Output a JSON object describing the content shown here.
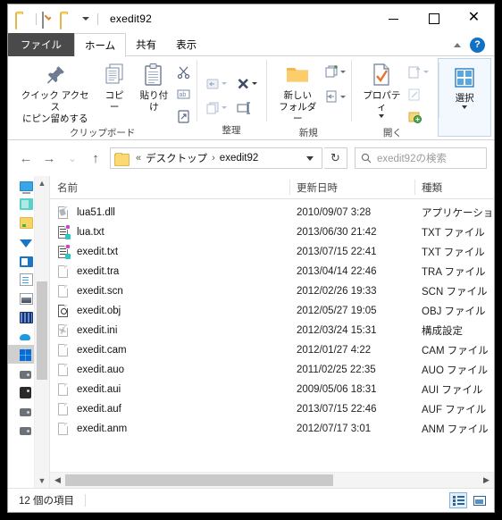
{
  "window": {
    "title": "exedit92",
    "quick_access": [
      "folder-icon",
      "properties-icon",
      "folder-icon"
    ],
    "controls": {
      "minimize": "minimize-icon",
      "maximize": "maximize-icon",
      "close": "close-icon"
    }
  },
  "tabs": [
    {
      "id": "file",
      "label": "ファイル"
    },
    {
      "id": "home",
      "label": "ホーム"
    },
    {
      "id": "share",
      "label": "共有"
    },
    {
      "id": "view",
      "label": "表示"
    }
  ],
  "ribbon": {
    "help_label": "?",
    "groups": [
      {
        "label": "クリップボード",
        "buttons": [
          {
            "label": "クイック アクセス\nにピン留めする",
            "label_line1": "クイック アクセス",
            "label_line2": "にピン留めする",
            "icon": "pin-icon"
          },
          {
            "label": "コピー",
            "icon": "copy-icon"
          },
          {
            "label": "貼り付け",
            "icon": "paste-icon"
          }
        ],
        "small_buttons": [
          {
            "name": "cut",
            "icon": "scissors-icon"
          },
          {
            "name": "copy-path",
            "icon": "copy-path-icon"
          },
          {
            "name": "paste-shortcut",
            "icon": "paste-shortcut-icon"
          }
        ]
      },
      {
        "label": "整理",
        "small_buttons": [
          {
            "name": "move-to",
            "icon": "move-to-icon"
          },
          {
            "name": "delete",
            "icon": "delete-x-icon"
          },
          {
            "name": "copy-to",
            "icon": "copy-to-icon"
          },
          {
            "name": "rename",
            "icon": "rename-icon"
          }
        ]
      },
      {
        "label": "新規",
        "buttons": [
          {
            "label": "新しい\nフォルダー",
            "label_line1": "新しい",
            "label_line2": "フォルダー",
            "icon": "new-folder-icon"
          }
        ],
        "small_buttons": [
          {
            "name": "new-item",
            "icon": "new-item-icon"
          },
          {
            "name": "easy-access",
            "icon": "easy-access-icon"
          }
        ]
      },
      {
        "label": "開く",
        "buttons": [
          {
            "label": "プロパティ",
            "icon": "properties-icon"
          }
        ],
        "small_buttons": [
          {
            "name": "open",
            "icon": "open-icon"
          },
          {
            "name": "edit",
            "icon": "edit-icon"
          },
          {
            "name": "history",
            "icon": "history-icon"
          }
        ]
      },
      {
        "label": "選択",
        "buttons": [
          {
            "label": "選択",
            "icon": "select-icon"
          }
        ]
      }
    ]
  },
  "addressbar": {
    "back": "back-arrow-icon",
    "forward": "forward-arrow-icon",
    "recent": "recent-locations-icon",
    "up": "up-arrow-icon",
    "folder_icon": "folder-icon",
    "overflow": "«",
    "crumbs": [
      "デスクトップ",
      "exedit92"
    ],
    "separator": "›",
    "dropdown": "chevron-down-icon",
    "refresh": "↻",
    "refresh_name": "refresh-icon"
  },
  "search": {
    "icon": "search-icon",
    "placeholder": "exedit92の検索"
  },
  "navpane": {
    "items": [
      {
        "name": "desktop",
        "icon": "monitor-icon",
        "selected": false
      },
      {
        "name": "onedrive",
        "icon": "teal-folder-icon",
        "selected": false
      },
      {
        "name": "documents",
        "icon": "yellow-folder-icon",
        "selected": false
      },
      {
        "name": "downloads",
        "icon": "download-arrow-icon",
        "selected": false
      },
      {
        "name": "this-pc",
        "icon": "blue-pc-icon",
        "selected": false
      },
      {
        "name": "docs-lib",
        "icon": "document-icon",
        "selected": false
      },
      {
        "name": "pictures",
        "icon": "picture-icon",
        "selected": false
      },
      {
        "name": "videos",
        "icon": "video-icon",
        "selected": false
      },
      {
        "name": "cloud",
        "icon": "cloud-icon",
        "selected": false
      },
      {
        "name": "windows-c",
        "icon": "windows-drive-icon",
        "selected": true
      },
      {
        "name": "drive-d",
        "icon": "drive-icon",
        "selected": false
      },
      {
        "name": "drive-e",
        "icon": "drive-dark-icon",
        "selected": false
      },
      {
        "name": "drive-f",
        "icon": "drive-icon",
        "selected": false
      },
      {
        "name": "drive-g",
        "icon": "drive-icon",
        "selected": false
      }
    ],
    "scroll_up": "▲",
    "scroll_down": "▼"
  },
  "columns": [
    {
      "id": "name",
      "label": "名前"
    },
    {
      "id": "date",
      "label": "更新日時"
    },
    {
      "id": "type",
      "label": "種類"
    }
  ],
  "files": [
    {
      "name": "lua51.dll",
      "date": "2010/09/07 3:28",
      "type": "アプリケーション",
      "icon": "dll-file-icon"
    },
    {
      "name": "lua.txt",
      "date": "2013/06/30 21:42",
      "type": "TXT ファイル",
      "icon": "text-file-icon"
    },
    {
      "name": "exedit.txt",
      "date": "2013/07/15 22:41",
      "type": "TXT ファイル",
      "icon": "text-file-icon"
    },
    {
      "name": "exedit.tra",
      "date": "2013/04/14 22:46",
      "type": "TRA ファイル",
      "icon": "generic-file-icon"
    },
    {
      "name": "exedit.scn",
      "date": "2012/02/26 19:33",
      "type": "SCN ファイル",
      "icon": "generic-file-icon"
    },
    {
      "name": "exedit.obj",
      "date": "2012/05/27 19:05",
      "type": "OBJ ファイル",
      "icon": "obj-file-icon"
    },
    {
      "name": "exedit.ini",
      "date": "2012/03/24 15:31",
      "type": "構成設定",
      "icon": "ini-file-icon"
    },
    {
      "name": "exedit.cam",
      "date": "2012/01/27 4:22",
      "type": "CAM ファイル",
      "icon": "generic-file-icon"
    },
    {
      "name": "exedit.auo",
      "date": "2011/02/25 22:35",
      "type": "AUO ファイル",
      "icon": "generic-file-icon"
    },
    {
      "name": "exedit.aui",
      "date": "2009/05/06 18:31",
      "type": "AUI ファイル",
      "icon": "generic-file-icon"
    },
    {
      "name": "exedit.auf",
      "date": "2013/07/15 22:46",
      "type": "AUF ファイル",
      "icon": "generic-file-icon"
    },
    {
      "name": "exedit.anm",
      "date": "2012/07/17 3:01",
      "type": "ANM ファイル",
      "icon": "generic-file-icon"
    }
  ],
  "statusbar": {
    "item_count": "12 個の項目",
    "view_details": "details-view-icon",
    "view_large": "large-icons-view-icon"
  },
  "colors": {
    "accent": "#1271c4",
    "folder": "#fbd975",
    "file_tab_bg": "#4a4a4a",
    "selected_nav": "#cfcfcf"
  }
}
